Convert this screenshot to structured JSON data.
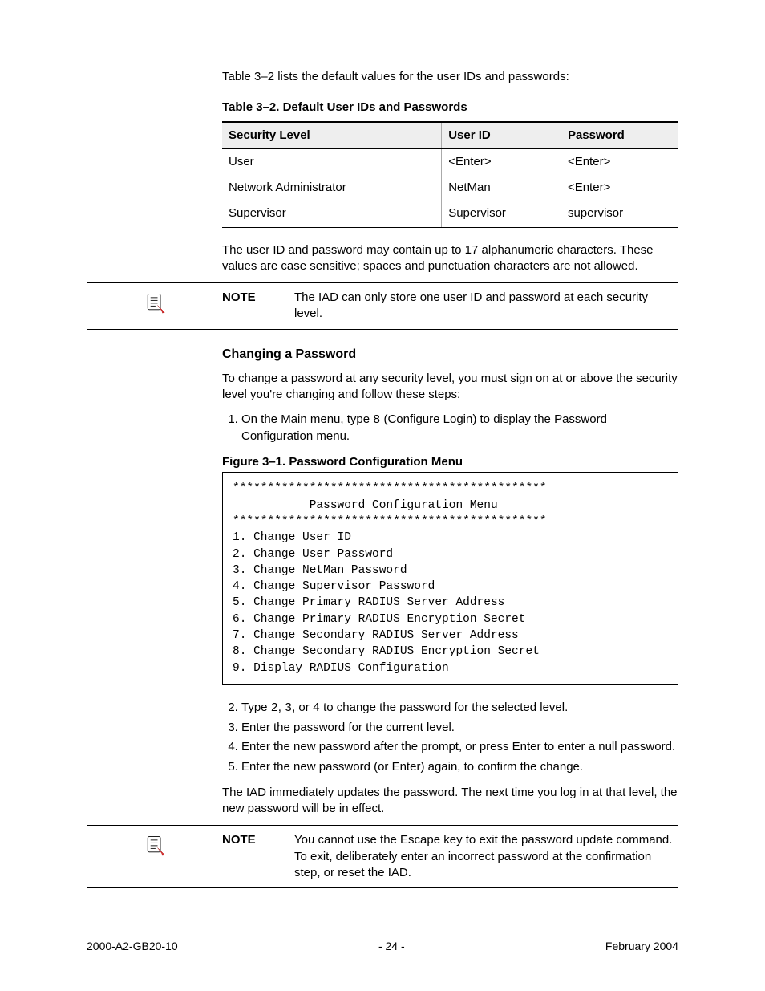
{
  "intro": "Table 3–2 lists the default values for the user IDs and passwords:",
  "table": {
    "caption": "Table 3–2.   Default User IDs and Passwords",
    "headers": [
      "Security Level",
      "User ID",
      "Password"
    ],
    "rows": [
      [
        "User",
        "<Enter>",
        "<Enter>"
      ],
      [
        "Network Administrator",
        "NetMan",
        "<Enter>"
      ],
      [
        "Supervisor",
        "Supervisor",
        "supervisor"
      ]
    ]
  },
  "after_table": "The user ID and password may contain up to 17 alphanumeric characters. These values are case sensitive; spaces and punctuation characters are not allowed.",
  "note1": {
    "label": "NOTE",
    "text": "The IAD can only store one user ID and password at each security level."
  },
  "section_heading": "Changing a Password",
  "section_intro": "To change a password at any security level, you must sign on at or above the security level you're changing and follow these steps:",
  "step1_prefix": "On the Main menu, type ",
  "step1_code": "8",
  "step1_suffix": " (Configure Login) to display the Password Configuration menu.",
  "figure_caption": "Figure 3–1.  Password Configuration Menu",
  "terminal": "*********************************************\n           Password Configuration Menu\n*********************************************\n1. Change User ID\n2. Change User Password\n3. Change NetMan Password\n4. Change Supervisor Password\n5. Change Primary RADIUS Server Address\n6. Change Primary RADIUS Encryption Secret\n7. Change Secondary RADIUS Server Address\n8. Change Secondary RADIUS Encryption Secret\n9. Display RADIUS Configuration",
  "step2_prefix": "Type ",
  "step2_c1": "2",
  "step2_mid1": ", ",
  "step2_c2": "3",
  "step2_mid2": ", or ",
  "step2_c3": "4",
  "step2_suffix": " to change the password for the selected level.",
  "step3": "Enter the password for the current level.",
  "step4": "Enter the new password after the prompt, or press Enter to enter a null password.",
  "step5": "Enter the new password (or Enter) again, to confirm the change.",
  "after_steps": "The IAD immediately updates the password. The next time you log in at that level, the new password will be in effect.",
  "note2": {
    "label": "NOTE",
    "text": "You cannot use the Escape key to exit the password update command. To exit, deliberately enter an incorrect password at the confirmation step, or reset the IAD."
  },
  "footer": {
    "left": "2000-A2-GB20-10",
    "center": "- 24 -",
    "right": "February 2004"
  }
}
